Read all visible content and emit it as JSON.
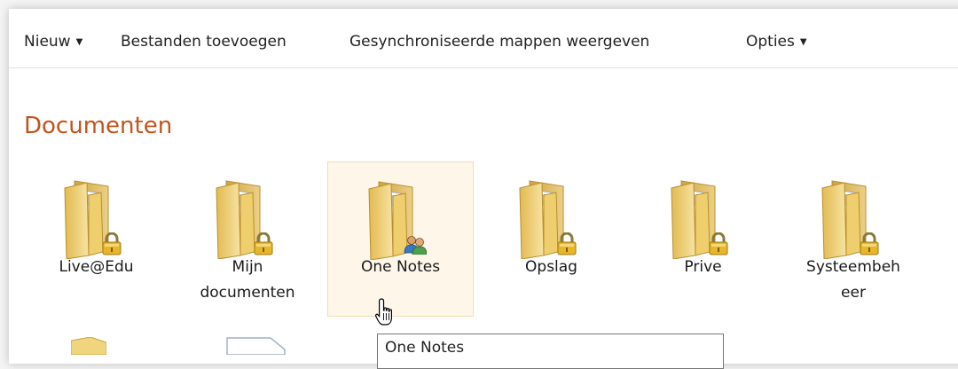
{
  "toolbar": {
    "new_label": "Nieuw",
    "add_files_label": "Bestanden toevoegen",
    "synced_folders_label": "Gesynchroniseerde mappen weergeven",
    "options_label": "Opties"
  },
  "section_title": "Documenten",
  "folders": [
    {
      "label": "Live@Edu",
      "badge": "lock-icon"
    },
    {
      "label": "Mijn documenten",
      "badge": "lock-icon"
    },
    {
      "label": "One Notes",
      "badge": "shared-users-icon"
    },
    {
      "label": "Opslag",
      "badge": "lock-icon"
    },
    {
      "label": "Prive",
      "badge": "lock-icon"
    },
    {
      "label": "Systeembeheer",
      "badge": "lock-icon"
    }
  ],
  "tooltip": {
    "text": "One Notes"
  },
  "colors": {
    "title": "#c5531c",
    "hover_bg": "#fdf6e9",
    "hover_border": "#f4ddb2",
    "folder": "#f0d57f"
  }
}
